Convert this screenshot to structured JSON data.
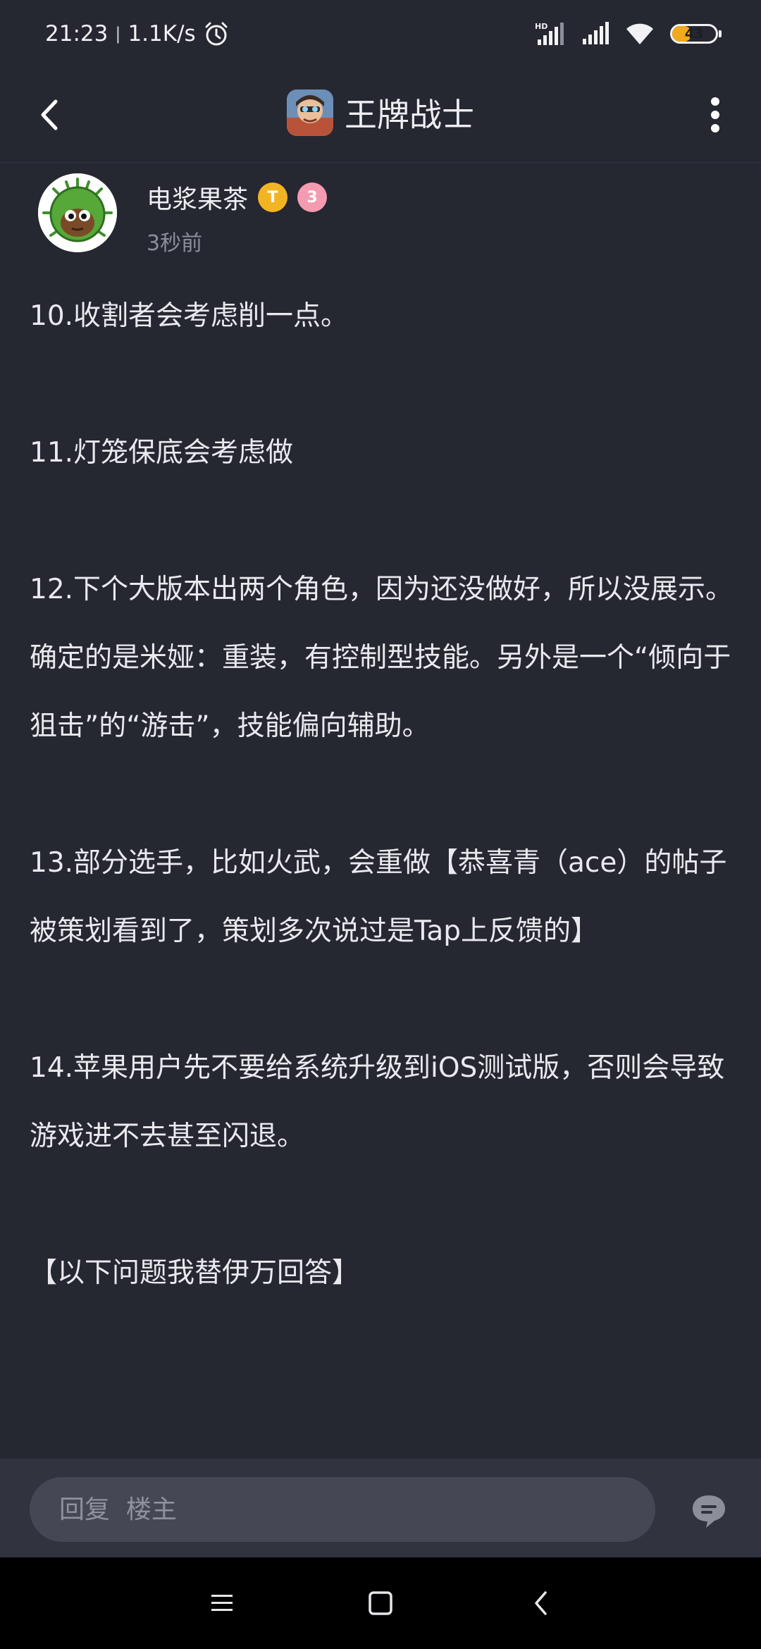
{
  "status_bar": {
    "time": "21:23",
    "separator": "|",
    "net_speed": "1.1K/s",
    "battery_level": "43",
    "battery_fraction": 0.43,
    "icons": [
      "alarm-icon",
      "hd-signal-icon",
      "signal-icon",
      "wifi-icon",
      "battery-icon"
    ]
  },
  "app_bar": {
    "title": "王牌战士",
    "back_icon": "back-arrow-icon",
    "more_icon": "more-vertical-icon"
  },
  "author": {
    "name": "电浆果茶",
    "badge_t": "T",
    "badge_level": "3",
    "time": "3秒前"
  },
  "post": {
    "paragraphs": [
      "10.收割者会考虑削一点。",
      "",
      "11.灯笼保底会考虑做",
      "",
      "12.下个大版本出两个角色，因为还没做好，所以没展示。\n确定的是米娅：重装，有控制型技能。另外是一个“倾向于狙击”的“游击”，技能偏向辅助。",
      "",
      "13.部分选手，比如火武，会重做【恭喜青（ace）的帖子被策划看到了，策划多次说过是Tap上反馈的】",
      "",
      "14.苹果用户先不要给系统升级到iOS测试版，否则会导致游戏进不去甚至闪退。",
      "",
      "【以下问题我替伊万回答】"
    ]
  },
  "reply": {
    "placeholder": "回复  楼主",
    "comment_icon": "comment-bubble-icon"
  },
  "nav_bar": {
    "icons": [
      "menu-icon",
      "home-square-icon",
      "back-triangle-icon"
    ]
  },
  "colors": {
    "background": "#252731",
    "reply_bar": "#31333e",
    "input": "#454755",
    "battery": "#f2a91d",
    "badge_gold": "#f3b424",
    "badge_pink": "#f59bb1"
  }
}
